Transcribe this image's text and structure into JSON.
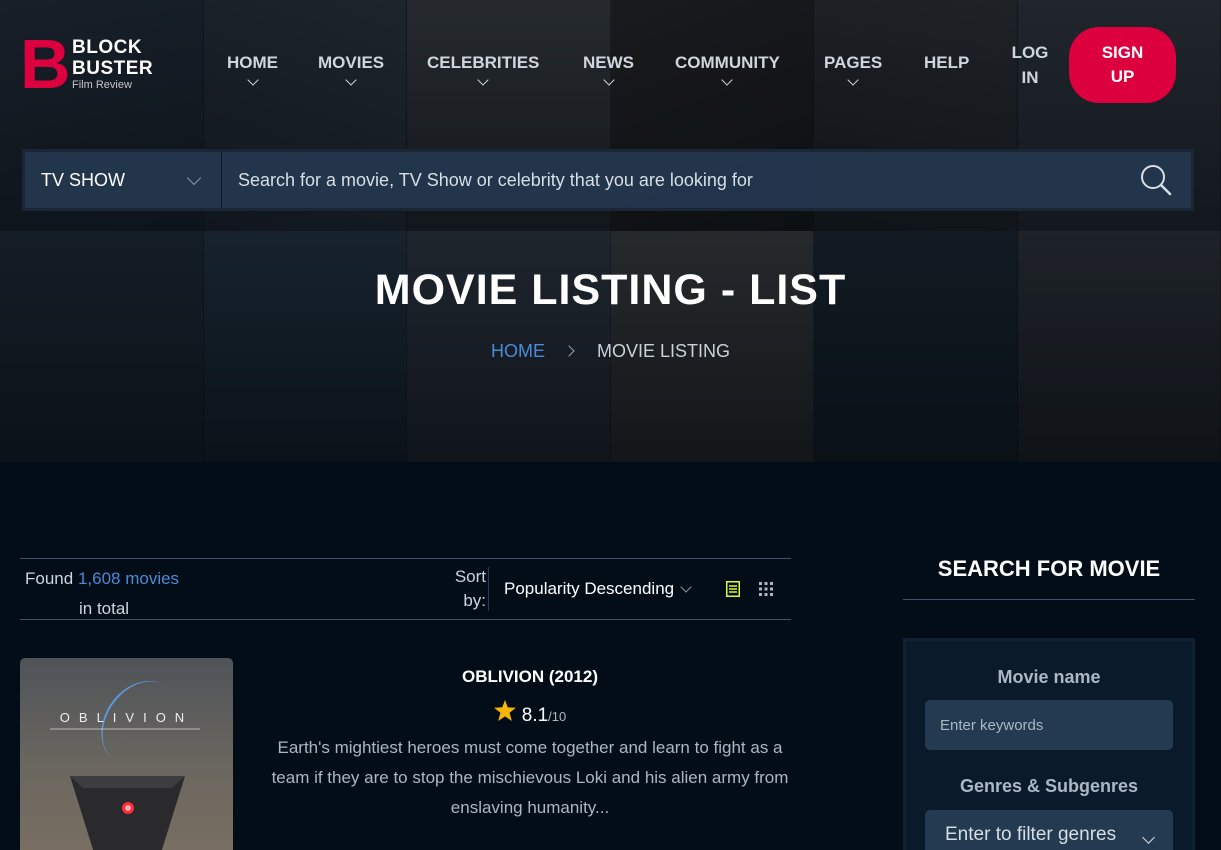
{
  "brand": {
    "line1": "BLOCK",
    "line2": "BUSTER",
    "tagline": "Film Review",
    "letter": "B",
    "accent": "#dd003f"
  },
  "nav": {
    "items": [
      {
        "label": "HOME",
        "dropdown": true
      },
      {
        "label": "MOVIES",
        "dropdown": true
      },
      {
        "label": "CELEBRITIES",
        "dropdown": true
      },
      {
        "label": "NEWS",
        "dropdown": true
      },
      {
        "label": "COMMUNITY",
        "dropdown": true
      },
      {
        "label": "PAGES",
        "dropdown": true
      },
      {
        "label": "HELP",
        "dropdown": false
      }
    ],
    "login_line1": "LOG",
    "login_line2": "IN",
    "signup_line1": "SIGN",
    "signup_line2": "UP"
  },
  "top_search": {
    "category": "TV SHOW",
    "placeholder": "Search for a movie, TV Show or celebrity that you are looking for",
    "icon": "search-icon"
  },
  "hero": {
    "title": "MOVIE LISTING - LIST",
    "breadcrumb": {
      "home": "HOME",
      "current": "MOVIE LISTING"
    }
  },
  "listing": {
    "found_prefix": "Found",
    "found_count": "1,608 movies",
    "found_suffix": "in total",
    "sort_line1": "Sort",
    "sort_line2": "by:",
    "sort_value": "Popularity Descending",
    "view_list_icon": "list-view-icon",
    "view_grid_icon": "grid-view-icon",
    "active_view_color": "#dcf836"
  },
  "movies": [
    {
      "title": "OBLIVION (2012)",
      "poster_title": "OBLIVION",
      "rating": "8.1",
      "rating_max": "/10",
      "description": "Earth's mightiest heroes must come together and learn to fight as a team if they are to stop the mischievous Loki and his alien army from enslaving humanity..."
    }
  ],
  "sidebar": {
    "title": "SEARCH FOR MOVIE",
    "movie_name_label": "Movie name",
    "movie_name_placeholder": "Enter keywords",
    "genres_label": "Genres & Subgenres",
    "genres_placeholder": "Enter to filter genres"
  }
}
